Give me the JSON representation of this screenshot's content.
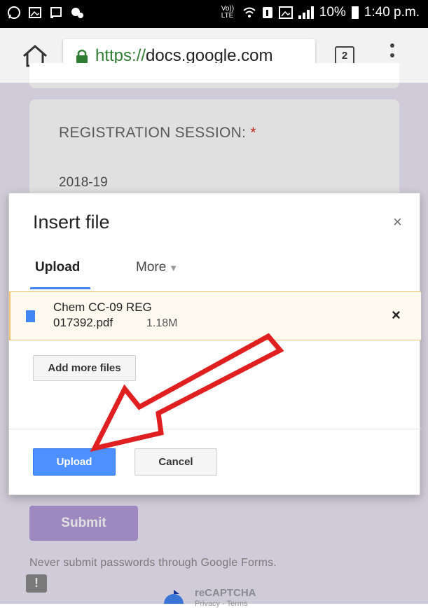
{
  "statusbar": {
    "left_icons": [
      "whatsapp-icon",
      "image-icon",
      "cast-icon",
      "settings-icon"
    ],
    "network_label": "Vo)) LTE",
    "battery_percent": "10%",
    "time": "1:40 p.m."
  },
  "browser": {
    "url_scheme": "https://",
    "url_host": "docs.google.com",
    "tab_count": "2"
  },
  "form": {
    "question_label": "REGISTRATION SESSION: ",
    "required_mark": "*",
    "answer": "2018-19",
    "submit_label": "Submit",
    "never_submit": "Never submit passwords through Google Forms.",
    "feedback_glyph": "!",
    "recaptcha_label": "reCAPTCHA",
    "recaptcha_sub": "Privacy - Terms"
  },
  "dialog": {
    "title": "Insert file",
    "close_glyph": "×",
    "tabs": {
      "upload": "Upload",
      "more": "More"
    },
    "file": {
      "name_line1": "Chem CC-09 REG",
      "name_line2": "017392.pdf",
      "size": "1.18M",
      "remove_glyph": "×"
    },
    "add_more_label": "Add more files",
    "upload_label": "Upload",
    "cancel_label": "Cancel"
  },
  "colors": {
    "accent_blue": "#4d90fe",
    "form_purple": "#b39ddb",
    "annotation_red": "#e02020"
  }
}
